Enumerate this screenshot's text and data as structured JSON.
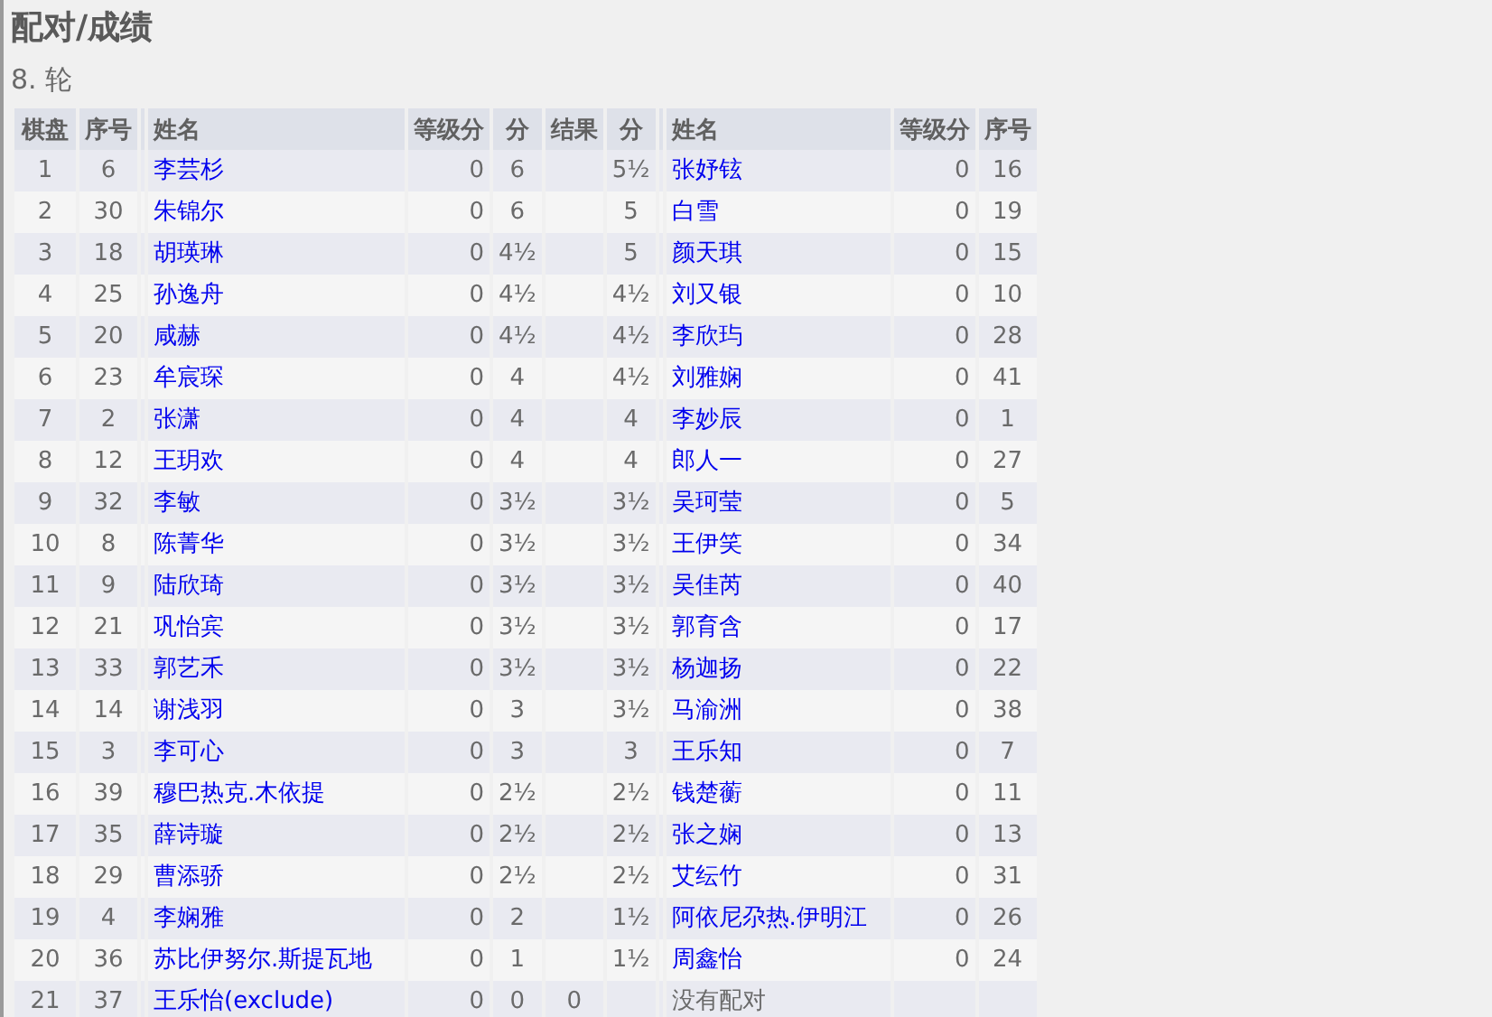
{
  "page_title": "配对/成绩",
  "round": "8. 轮",
  "table": {
    "columns": [
      "棋盘",
      "序号",
      "姓名",
      "等级分",
      "分",
      "结果",
      "分",
      "姓名",
      "等级分",
      "序号"
    ],
    "rows": [
      {
        "board": "1",
        "white": {
          "kind": "player",
          "no": "6",
          "name": "李芸杉",
          "rating": "0",
          "points": "6"
        },
        "result": "",
        "black": {
          "kind": "player",
          "points": "5½",
          "name": "张妤铉",
          "rating": "0",
          "no": "16"
        }
      },
      {
        "board": "2",
        "white": {
          "kind": "player",
          "no": "30",
          "name": "朱锦尔",
          "rating": "0",
          "points": "6"
        },
        "result": "",
        "black": {
          "kind": "player",
          "points": "5",
          "name": "白雪",
          "rating": "0",
          "no": "19"
        }
      },
      {
        "board": "3",
        "white": {
          "kind": "player",
          "no": "18",
          "name": "胡瑛琳",
          "rating": "0",
          "points": "4½"
        },
        "result": "",
        "black": {
          "kind": "player",
          "points": "5",
          "name": "颜天琪",
          "rating": "0",
          "no": "15"
        }
      },
      {
        "board": "4",
        "white": {
          "kind": "player",
          "no": "25",
          "name": "孙逸舟",
          "rating": "0",
          "points": "4½"
        },
        "result": "",
        "black": {
          "kind": "player",
          "points": "4½",
          "name": "刘又银",
          "rating": "0",
          "no": "10"
        }
      },
      {
        "board": "5",
        "white": {
          "kind": "player",
          "no": "20",
          "name": "咸赫",
          "rating": "0",
          "points": "4½"
        },
        "result": "",
        "black": {
          "kind": "player",
          "points": "4½",
          "name": "李欣玙",
          "rating": "0",
          "no": "28"
        }
      },
      {
        "board": "6",
        "white": {
          "kind": "player",
          "no": "23",
          "name": "牟宸琛",
          "rating": "0",
          "points": "4"
        },
        "result": "",
        "black": {
          "kind": "player",
          "points": "4½",
          "name": "刘雅娴",
          "rating": "0",
          "no": "41"
        }
      },
      {
        "board": "7",
        "white": {
          "kind": "player",
          "no": "2",
          "name": "张潇",
          "rating": "0",
          "points": "4"
        },
        "result": "",
        "black": {
          "kind": "player",
          "points": "4",
          "name": "李妙辰",
          "rating": "0",
          "no": "1"
        }
      },
      {
        "board": "8",
        "white": {
          "kind": "player",
          "no": "12",
          "name": "王玥欢",
          "rating": "0",
          "points": "4"
        },
        "result": "",
        "black": {
          "kind": "player",
          "points": "4",
          "name": "郎人一",
          "rating": "0",
          "no": "27"
        }
      },
      {
        "board": "9",
        "white": {
          "kind": "player",
          "no": "32",
          "name": "李敏",
          "rating": "0",
          "points": "3½"
        },
        "result": "",
        "black": {
          "kind": "player",
          "points": "3½",
          "name": "吴珂莹",
          "rating": "0",
          "no": "5"
        }
      },
      {
        "board": "10",
        "white": {
          "kind": "player",
          "no": "8",
          "name": "陈菁华",
          "rating": "0",
          "points": "3½"
        },
        "result": "",
        "black": {
          "kind": "player",
          "points": "3½",
          "name": "王伊笑",
          "rating": "0",
          "no": "34"
        }
      },
      {
        "board": "11",
        "white": {
          "kind": "player",
          "no": "9",
          "name": "陆欣琦",
          "rating": "0",
          "points": "3½"
        },
        "result": "",
        "black": {
          "kind": "player",
          "points": "3½",
          "name": "吴佳芮",
          "rating": "0",
          "no": "40"
        }
      },
      {
        "board": "12",
        "white": {
          "kind": "player",
          "no": "21",
          "name": "巩怡宾",
          "rating": "0",
          "points": "3½"
        },
        "result": "",
        "black": {
          "kind": "player",
          "points": "3½",
          "name": "郭育含",
          "rating": "0",
          "no": "17"
        }
      },
      {
        "board": "13",
        "white": {
          "kind": "player",
          "no": "33",
          "name": "郭艺禾",
          "rating": "0",
          "points": "3½"
        },
        "result": "",
        "black": {
          "kind": "player",
          "points": "3½",
          "name": "杨迦扬",
          "rating": "0",
          "no": "22"
        }
      },
      {
        "board": "14",
        "white": {
          "kind": "player",
          "no": "14",
          "name": "谢浅羽",
          "rating": "0",
          "points": "3"
        },
        "result": "",
        "black": {
          "kind": "player",
          "points": "3½",
          "name": "马渝洲",
          "rating": "0",
          "no": "38"
        }
      },
      {
        "board": "15",
        "white": {
          "kind": "player",
          "no": "3",
          "name": "李可心",
          "rating": "0",
          "points": "3"
        },
        "result": "",
        "black": {
          "kind": "player",
          "points": "3",
          "name": "王乐知",
          "rating": "0",
          "no": "7"
        }
      },
      {
        "board": "16",
        "white": {
          "kind": "player",
          "no": "39",
          "name": "穆巴热克.木依提",
          "rating": "0",
          "points": "2½"
        },
        "result": "",
        "black": {
          "kind": "player",
          "points": "2½",
          "name": "钱楚蘅",
          "rating": "0",
          "no": "11"
        }
      },
      {
        "board": "17",
        "white": {
          "kind": "player",
          "no": "35",
          "name": "薛诗璇",
          "rating": "0",
          "points": "2½"
        },
        "result": "",
        "black": {
          "kind": "player",
          "points": "2½",
          "name": "张之娴",
          "rating": "0",
          "no": "13"
        }
      },
      {
        "board": "18",
        "white": {
          "kind": "player",
          "no": "29",
          "name": "曹添骄",
          "rating": "0",
          "points": "2½"
        },
        "result": "",
        "black": {
          "kind": "player",
          "points": "2½",
          "name": "艾纭竹",
          "rating": "0",
          "no": "31"
        }
      },
      {
        "board": "19",
        "white": {
          "kind": "player",
          "no": "4",
          "name": "李娴雅",
          "rating": "0",
          "points": "2"
        },
        "result": "",
        "black": {
          "kind": "player",
          "points": "1½",
          "name": "阿依尼尕热.伊明江",
          "rating": "0",
          "no": "26"
        }
      },
      {
        "board": "20",
        "white": {
          "kind": "player",
          "no": "36",
          "name": "苏比伊努尔.斯提瓦地",
          "rating": "0",
          "points": "1"
        },
        "result": "",
        "black": {
          "kind": "player",
          "points": "1½",
          "name": "周鑫怡",
          "rating": "0",
          "no": "24"
        }
      },
      {
        "board": "21",
        "white": {
          "kind": "player",
          "no": "37",
          "name": "王乐怡(exclude)",
          "rating": "0",
          "points": "0"
        },
        "result": "0",
        "black": {
          "kind": "bye",
          "name": "没有配对"
        }
      }
    ]
  }
}
